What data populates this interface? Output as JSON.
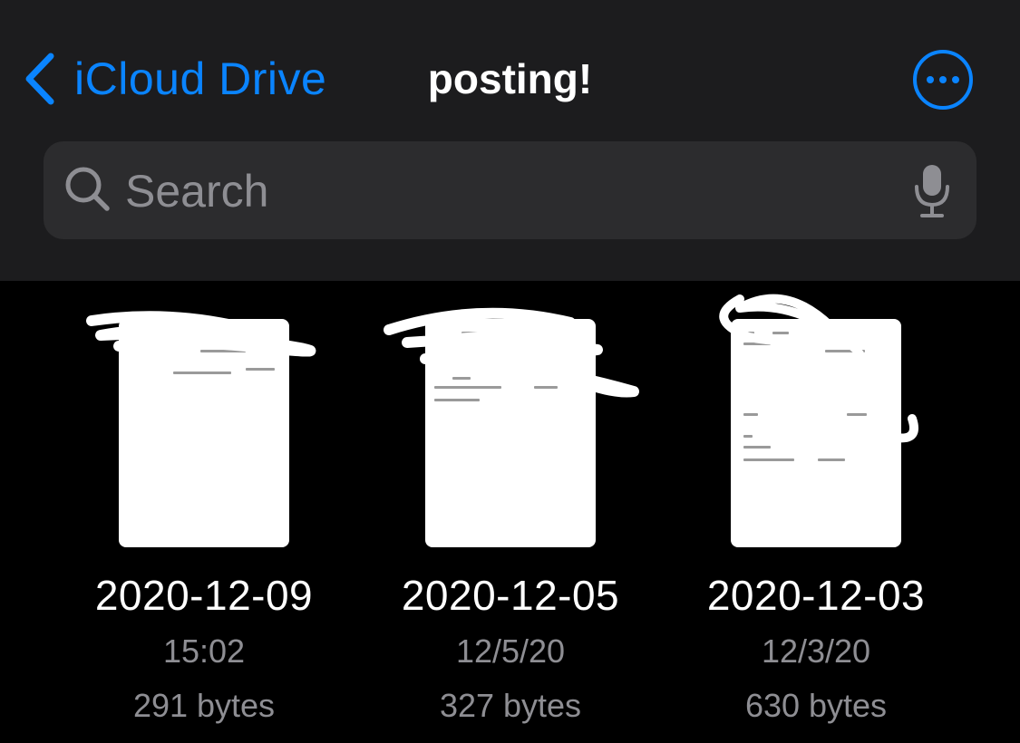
{
  "nav": {
    "back_label": "iCloud Drive",
    "title": "posting!",
    "more_icon": "ellipsis-circle-icon"
  },
  "search": {
    "placeholder": "Search",
    "value": ""
  },
  "files": [
    {
      "name": "2020-12-09",
      "date": "15:02",
      "size": "291 bytes"
    },
    {
      "name": "2020-12-05",
      "date": "12/5/20",
      "size": "327 bytes"
    },
    {
      "name": "2020-12-03",
      "date": "12/3/20",
      "size": "630 bytes"
    }
  ],
  "colors": {
    "accent": "#0a84ff",
    "header_bg": "#1c1c1e",
    "search_bg": "#2c2c2e",
    "content_bg": "#000000",
    "secondary_text": "#8e8e93"
  }
}
